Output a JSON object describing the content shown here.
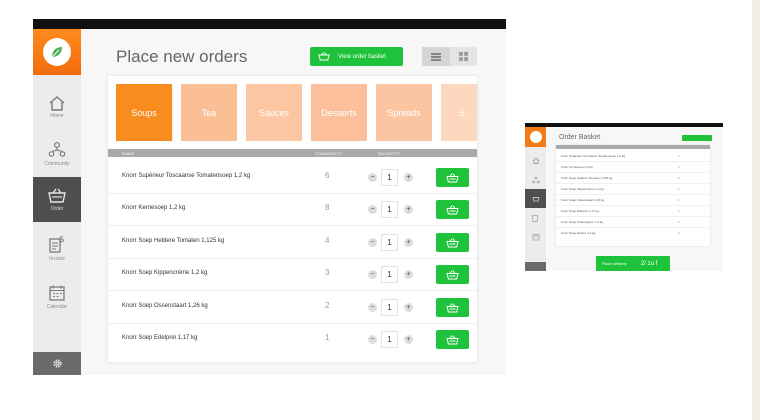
{
  "main": {
    "page_title": "Place new orders",
    "basket_button": "View order basket",
    "nav": [
      {
        "label": "Home",
        "icon": "home-icon"
      },
      {
        "label": "Community",
        "icon": "community-icon"
      },
      {
        "label": "Order",
        "icon": "basket-icon"
      },
      {
        "label": "Invoice",
        "icon": "invoice-icon"
      },
      {
        "label": "Calendar",
        "icon": "calendar-icon"
      }
    ],
    "categories": [
      "Soups",
      "Tea",
      "Sauces",
      "Desserts",
      "Spreads",
      "S"
    ],
    "columns": {
      "name": "NAME",
      "amount": "COMMONITY",
      "quantity": "QUANTITY"
    },
    "products": [
      {
        "name": "Knorr Supérieur Toscaanse Tomatensoep 1,2 kg",
        "amount": "6",
        "qty": "1"
      },
      {
        "name": "Knorr Kerriesoep 1,2 kg",
        "amount": "8",
        "qty": "1"
      },
      {
        "name": "Knorr Soep Heldere Tomaten 1,125 kg",
        "amount": "4",
        "qty": "1"
      },
      {
        "name": "Knorr Soep Kippencrème 1,2 kg",
        "amount": "3",
        "qty": "1"
      },
      {
        "name": "Knorr Soep Ossenstaart 1,26 kg",
        "amount": "2",
        "qty": "1"
      },
      {
        "name": "Knorr Soep Edelprei 1,17 kg",
        "amount": "1",
        "qty": "1"
      }
    ],
    "minus": "−",
    "plus": "+"
  },
  "basket_preview": {
    "title": "Order Basket",
    "rows": [
      {
        "name": "Knorr Supérieur Toscaanse Tomatensoep 1,2 kg",
        "qty": "1"
      },
      {
        "name": "Knorr Kerriesoep 1,2 kg",
        "qty": "1"
      },
      {
        "name": "Knorr Soep Heldere Tomaten 1,125 kg",
        "qty": "2"
      },
      {
        "name": "Knorr Soep Kippencrème 1,2 kg",
        "qty": "1"
      },
      {
        "name": "Knorr Soep Ossenstaart 1,26 kg",
        "qty": "1"
      },
      {
        "name": "Knorr Soep Edelprei 1,17 kg",
        "qty": "1"
      },
      {
        "name": "Knorr Soep Champignon 1,2 kg",
        "qty": "1"
      },
      {
        "name": "Knorr Soep Erwten 1,2 kg",
        "qty": "4"
      }
    ],
    "place_button": "Place delivery",
    "place_extra": "2/ zu f"
  },
  "colors": {
    "accent_green": "#1fc23b",
    "brand_orange": "#f47a14",
    "category_gradient": [
      "#f98c1e",
      "#fbbf96",
      "#fdd8bf"
    ]
  }
}
